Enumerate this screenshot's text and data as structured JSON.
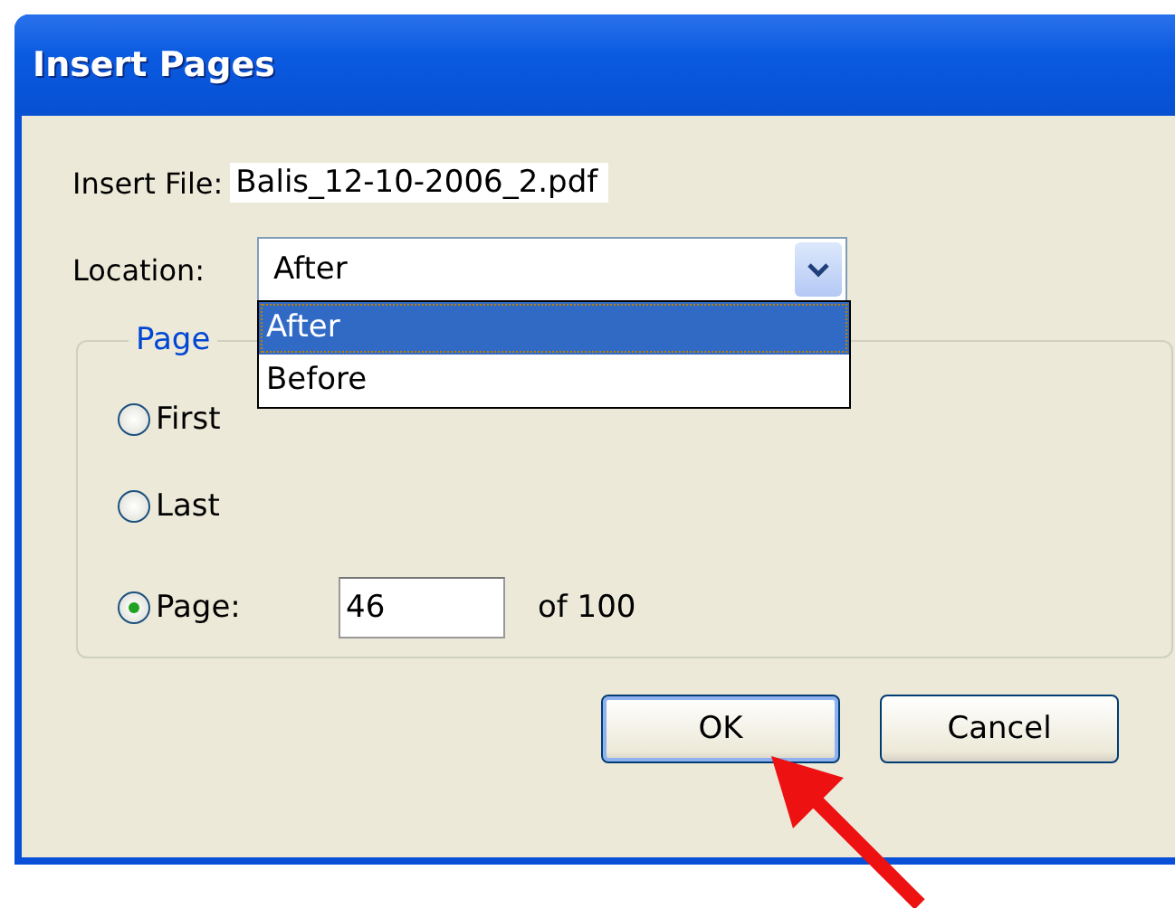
{
  "window": {
    "title": "Insert Pages"
  },
  "insert_file": {
    "label": "Insert File:",
    "value": "Balis_12-10-2006_2.pdf"
  },
  "location": {
    "label": "Location:",
    "value": "After",
    "expanded": true,
    "options": [
      {
        "label": "After",
        "selected": true
      },
      {
        "label": "Before",
        "selected": false
      }
    ]
  },
  "page_group": {
    "title": "Page",
    "options": [
      {
        "label": "First",
        "selected": false
      },
      {
        "label": "Last",
        "selected": false
      },
      {
        "label": "Page:",
        "selected": true,
        "field": "46",
        "suffix": "of 100"
      }
    ]
  },
  "buttons": [
    {
      "label": "OK",
      "default": true
    },
    {
      "label": "Cancel",
      "default": false
    }
  ]
}
